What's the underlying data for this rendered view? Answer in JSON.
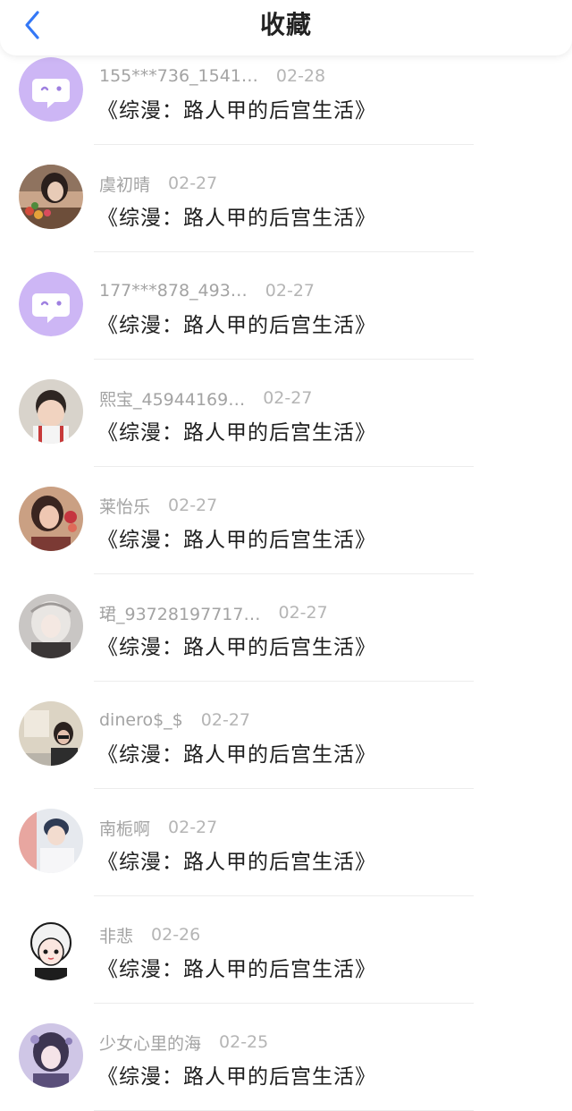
{
  "header": {
    "title": "收藏",
    "back_icon": "chevron-left-icon",
    "accent_color": "#3478f6"
  },
  "favorites": [
    {
      "user": "155***736_1541…",
      "date": "02-28",
      "title": "《综漫：路人甲的后宫生活》",
      "avatar": "default-chat-avatar"
    },
    {
      "user": "虞初晴",
      "date": "02-27",
      "title": "《综漫：路人甲的后宫生活》",
      "avatar": "photo-avatar"
    },
    {
      "user": "177***878_493…",
      "date": "02-27",
      "title": "《综漫：路人甲的后宫生活》",
      "avatar": "default-chat-avatar"
    },
    {
      "user": "熙宝_45944169…",
      "date": "02-27",
      "title": "《综漫：路人甲的后宫生活》",
      "avatar": "photo-avatar"
    },
    {
      "user": "莱怡乐",
      "date": "02-27",
      "title": "《综漫：路人甲的后宫生活》",
      "avatar": "photo-avatar"
    },
    {
      "user": "珺_93728197717…",
      "date": "02-27",
      "title": "《综漫：路人甲的后宫生活》",
      "avatar": "photo-avatar"
    },
    {
      "user": "dinero$_$",
      "date": "02-27",
      "title": "《综漫：路人甲的后宫生活》",
      "avatar": "photo-avatar"
    },
    {
      "user": "南栀啊",
      "date": "02-27",
      "title": "《综漫：路人甲的后宫生活》",
      "avatar": "photo-avatar"
    },
    {
      "user": "非悲",
      "date": "02-26",
      "title": "《综漫：路人甲的后宫生活》",
      "avatar": "photo-avatar"
    },
    {
      "user": "少女心里的海",
      "date": "02-25",
      "title": "《综漫：路人甲的后宫生活》",
      "avatar": "photo-avatar"
    }
  ]
}
